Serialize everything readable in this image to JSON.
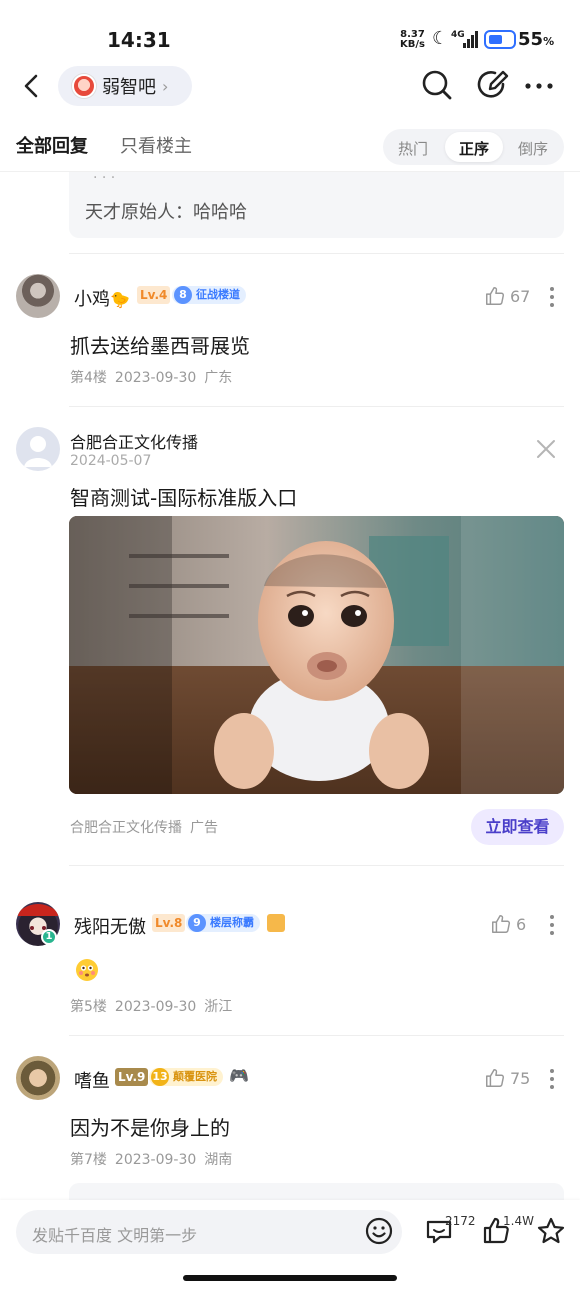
{
  "status_bar": {
    "time": "14:31",
    "net_speed_value": "8.37",
    "net_speed_unit": "KB/s",
    "network": "4G",
    "battery": "55",
    "battery_unit": "%"
  },
  "nav": {
    "forum_name": "弱智吧",
    "forum_chevron": "›"
  },
  "tabs": {
    "all_replies": "全部回复",
    "op_only": "只看楼主",
    "sort_hot": "热门",
    "sort_asc": "正序",
    "sort_desc": "倒序",
    "active_sort": "正序"
  },
  "quote": {
    "text": "天才原始人：哈哈哈"
  },
  "replies": [
    {
      "username": "小鸡",
      "user_emoji": "🐤",
      "level": "Lv.4",
      "badge_num": "8",
      "badge": "征战楼道",
      "likes": "67",
      "content": "抓去送给墨西哥展览",
      "floor": "第4楼",
      "date": "2023-09-30",
      "location": "广东"
    },
    {
      "username": "残阳无傲",
      "level": "Lv.8",
      "badge_num": "9",
      "badge": "楼层称霸",
      "likes": "6",
      "content_emoji": "😳",
      "floor": "第5楼",
      "date": "2023-09-30",
      "location": "浙江",
      "avatar_badge": "1"
    },
    {
      "username": "嗜鱼",
      "level": "Lv.9",
      "badge_num": "13",
      "badge": "颠覆医院",
      "extra_emoji": "🎮",
      "likes": "75",
      "content": "因为不是你身上的",
      "floor": "第7楼",
      "date": "2023-09-30",
      "location": "湖南"
    }
  ],
  "ad": {
    "advertiser": "合肥合正文化传播",
    "date": "2024-05-07",
    "headline": "智商测试-国际标准版入口",
    "source": "合肥合正文化传播",
    "ad_label": "广告",
    "cta": "立即查看"
  },
  "bottom_bar": {
    "input_placeholder": "发贴千百度 文明第一步",
    "comments_count": "2172",
    "likes_count": "1.4W"
  },
  "colors": {
    "accent": "#4a3fc9",
    "level_orange": "#f6a04d",
    "badge_blue": "#4f8cff",
    "badge_gold": "#f2b318"
  }
}
